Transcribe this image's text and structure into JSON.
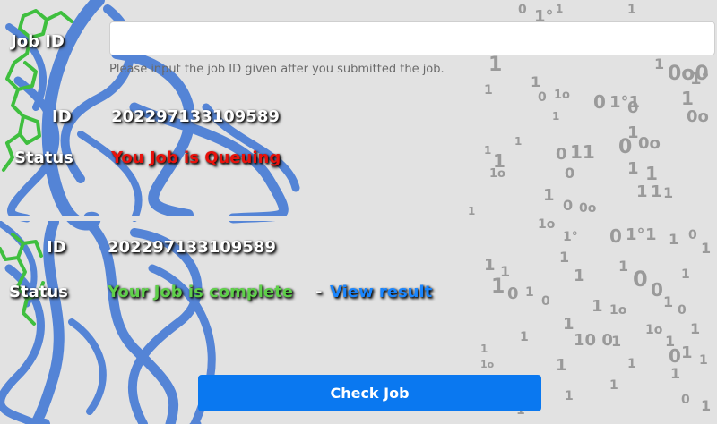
{
  "form": {
    "job_id_label": "Job ID",
    "input_value": "",
    "help_text": "Please input the job ID given after you submitted the job."
  },
  "queued": {
    "id_label": "ID",
    "id_value": "202297133109589",
    "status_label": "Status",
    "status_text": "You Job is Queuing"
  },
  "completed": {
    "id_label": "ID",
    "id_value": "202297133109589",
    "status_label": "Status",
    "status_text": "Your Job is complete",
    "separator": "-",
    "link_text": "View result"
  },
  "button": {
    "label": "Check Job"
  },
  "colors": {
    "queued_status": "#e8120c",
    "complete_status": "#5fd04a",
    "link": "#1a86ff",
    "button": "#0a78f0",
    "ribbon": "#4d7fd6",
    "ligand": "#3fbf3f"
  }
}
